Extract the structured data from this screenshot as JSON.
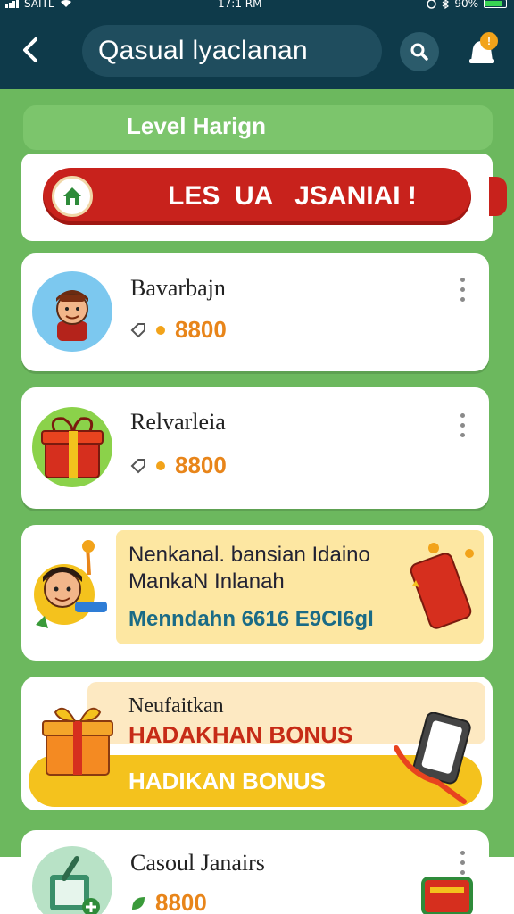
{
  "status_bar": {
    "carrier": "SAITL",
    "time": "17:1 RM",
    "battery": "90%",
    "battery_level": 0.9
  },
  "header": {
    "search_text": "Qasual lyaclanan",
    "notification_count": "!"
  },
  "section": {
    "title": "Level Harign"
  },
  "banner": {
    "text": "LES  UA   JSANIAI !"
  },
  "items": [
    {
      "title": "Bavarbajn",
      "reward": "8800"
    },
    {
      "title": "Relvarleia",
      "reward": "8800"
    }
  ],
  "promo": {
    "line1": "Nenkanal. bansian Idaino",
    "line2": "MankaN Inlanah",
    "subtitle": "Menndahn 6616 E9CI6gl"
  },
  "bonus": {
    "title": "Neufaitkan",
    "headline": "HADAKHAN BONUS",
    "cta": "HADIKAN BONUS"
  },
  "bottom_item": {
    "title": "Casoul Janairs",
    "reward": "8800"
  },
  "colors": {
    "header_bg": "#0e3a4a",
    "page_bg": "#6cb85e",
    "banner_red": "#c8221c",
    "reward_orange": "#e8851a",
    "bonus_yellow": "#f4c21d"
  }
}
